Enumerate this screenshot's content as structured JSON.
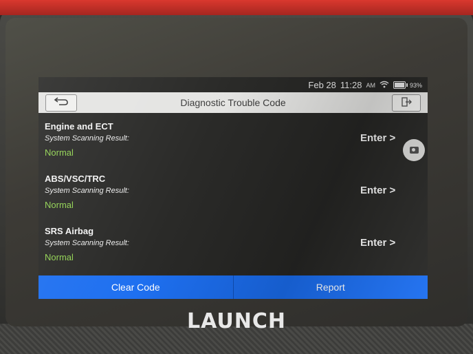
{
  "status_bar": {
    "date": "Feb 28",
    "time": "11:28",
    "time_suffix": "AM",
    "battery": "93%"
  },
  "header": {
    "title": "Diagnostic Trouble Code"
  },
  "systems": [
    {
      "name": "Engine and ECT",
      "label": "System Scanning Result:",
      "status": "Normal",
      "action": "Enter >"
    },
    {
      "name": "ABS/VSC/TRC",
      "label": "System Scanning Result:",
      "status": "Normal",
      "action": "Enter >"
    },
    {
      "name": "SRS Airbag",
      "label": "System Scanning Result:",
      "status": "Normal",
      "action": "Enter >"
    }
  ],
  "footer": {
    "clear_code": "Clear Code",
    "report": "Report"
  },
  "device": {
    "brand": "LAUNCH"
  },
  "colors": {
    "accent": "#1a6df0",
    "status_ok": "#8fd14f"
  },
  "icons": [
    "back-arrow-icon",
    "exit-icon",
    "wifi-icon",
    "battery-icon",
    "camera-icon"
  ]
}
